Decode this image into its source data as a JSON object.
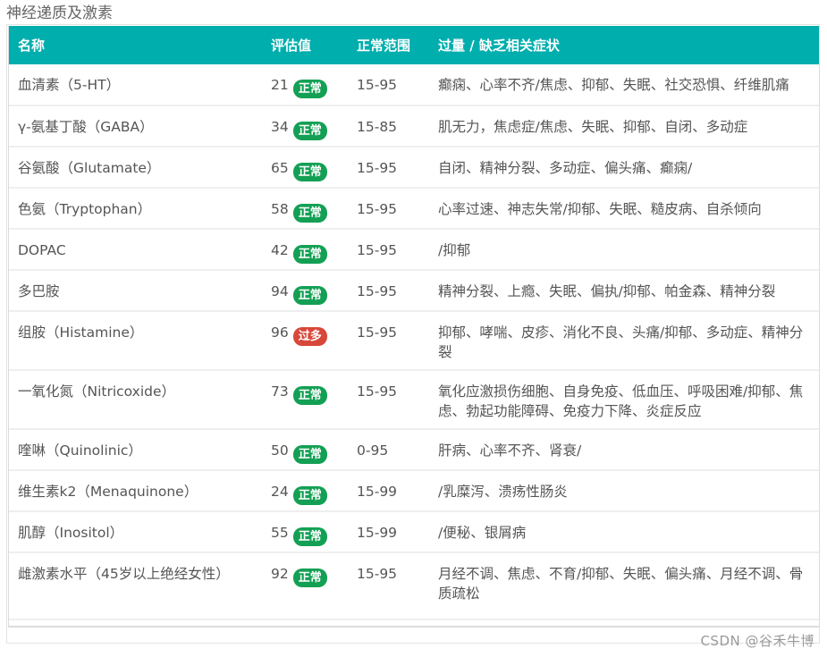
{
  "section_title": "神经递质及激素",
  "table": {
    "headers": {
      "name": "名称",
      "value": "评估值",
      "range": "正常范围",
      "symptoms": "过量 / 缺乏相关症状"
    },
    "rows": [
      {
        "name": "血清素（5-HT）",
        "value": "21",
        "status": "正常",
        "status_type": "normal",
        "range": "15-95",
        "symptoms": "癫痫、心率不齐/焦虑、抑郁、失眠、社交恐惧、纤维肌痛"
      },
      {
        "name": "γ-氨基丁酸（GABA）",
        "value": "34",
        "status": "正常",
        "status_type": "normal",
        "range": "15-85",
        "symptoms": "肌无力，焦虑症/焦虑、失眠、抑郁、自闭、多动症"
      },
      {
        "name": "谷氨酸（Glutamate）",
        "value": "65",
        "status": "正常",
        "status_type": "normal",
        "range": "15-95",
        "symptoms": "自闭、精神分裂、多动症、偏头痛、癫痫/"
      },
      {
        "name": "色氨（Tryptophan）",
        "value": "58",
        "status": "正常",
        "status_type": "normal",
        "range": "15-95",
        "symptoms": "心率过速、神志失常/抑郁、失眠、糙皮病、自杀倾向"
      },
      {
        "name": "DOPAC",
        "value": "42",
        "status": "正常",
        "status_type": "normal",
        "range": "15-95",
        "symptoms": "/抑郁"
      },
      {
        "name": "多巴胺",
        "value": "94",
        "status": "正常",
        "status_type": "normal",
        "range": "15-95",
        "symptoms": "精神分裂、上瘾、失眠、偏执/抑郁、帕金森、精神分裂"
      },
      {
        "name": "组胺（Histamine）",
        "value": "96",
        "status": "过多",
        "status_type": "high",
        "range": "15-95",
        "symptoms": "抑郁、哮喘、皮疹、消化不良、头痛/抑郁、多动症、精神分裂"
      },
      {
        "name": "一氧化氮（Nitricoxide）",
        "value": "73",
        "status": "正常",
        "status_type": "normal",
        "range": "15-95",
        "symptoms": "氧化应激损伤细胞、自身免疫、低血压、呼吸困难/抑郁、焦虑、勃起功能障碍、免疫力下降、炎症反应"
      },
      {
        "name": "喹啉（Quinolinic）",
        "value": "50",
        "status": "正常",
        "status_type": "normal",
        "range": "0-95",
        "symptoms": "肝病、心率不齐、肾衰/"
      },
      {
        "name": "维生素k2（Menaquinone）",
        "value": "24",
        "status": "正常",
        "status_type": "normal",
        "range": "15-99",
        "symptoms": "/乳糜泻、溃疡性肠炎"
      },
      {
        "name": "肌醇（Inositol）",
        "value": "55",
        "status": "正常",
        "status_type": "normal",
        "range": "15-99",
        "symptoms": "/便秘、银屑病"
      },
      {
        "name": "雌激素水平（45岁以上绝经女性）",
        "value": "92",
        "status": "正常",
        "status_type": "normal",
        "range": "15-95",
        "symptoms": "月经不调、焦虑、不育/抑郁、失眠、偏头痛、月经不调、骨质疏松"
      }
    ]
  },
  "colors": {
    "header_bg": "#00aead",
    "badge_normal": "#13a054",
    "badge_high": "#d8483a"
  },
  "watermark": "CSDN @谷禾牛博"
}
